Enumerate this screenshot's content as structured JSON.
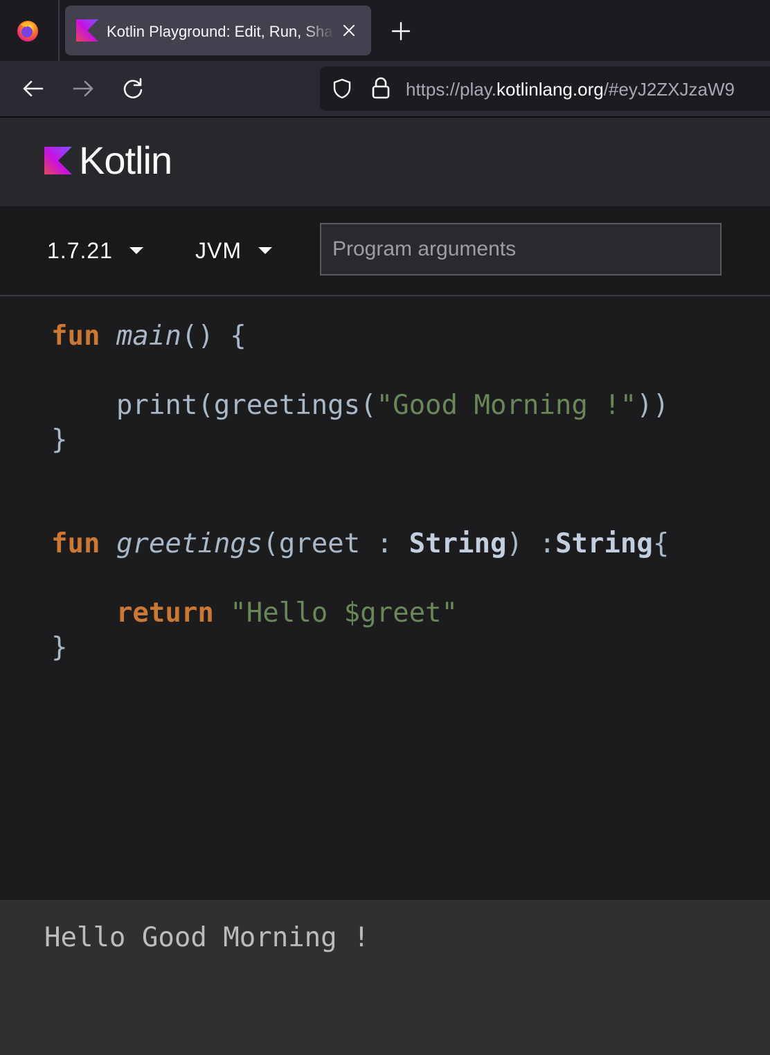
{
  "browser": {
    "tab": {
      "title": "Kotlin Playground: Edit, Run, Share Kotlin Code Online"
    },
    "url": {
      "scheme": "https://play.",
      "domain": "kotlinlang.org",
      "rest": "/#eyJ2ZXJzaW9"
    },
    "icons": {
      "browser_logo": "firefox-logo-icon",
      "tab_favicon": "kotlin-favicon-icon",
      "tab_close": "close-icon",
      "new_tab": "plus-icon",
      "back": "arrow-left-icon",
      "forward": "arrow-right-icon",
      "reload": "reload-icon",
      "tracking": "shield-icon",
      "secure": "lock-icon"
    }
  },
  "header": {
    "logo_text": "Kotlin"
  },
  "toolbar": {
    "version": "1.7.21",
    "target": "JVM",
    "args_placeholder": "Program arguments",
    "args_value": ""
  },
  "code": {
    "l1_kw": "fun",
    "l1_name": "main",
    "l1_rest": "() {",
    "l2_call": "print(greetings(",
    "l2_str": "\"Good Morning !\"",
    "l2_end": "))",
    "l3": "}",
    "l4_kw": "fun",
    "l4_name": "greetings",
    "l4_open": "(greet : ",
    "l4_type1": "String",
    "l4_mid": ") :",
    "l4_type2": "String",
    "l4_brace": "{",
    "l5_kw": "return",
    "l5_str": "\"Hello $greet\"",
    "l6": "}"
  },
  "output": {
    "text": "Hello Good Morning !"
  },
  "colors": {
    "keyword": "#cc7832",
    "string": "#6a8759",
    "plain": "#a9b7c6",
    "type": "#c3cfde",
    "editor_bg": "#1c1c1e",
    "output_bg": "#303033"
  }
}
